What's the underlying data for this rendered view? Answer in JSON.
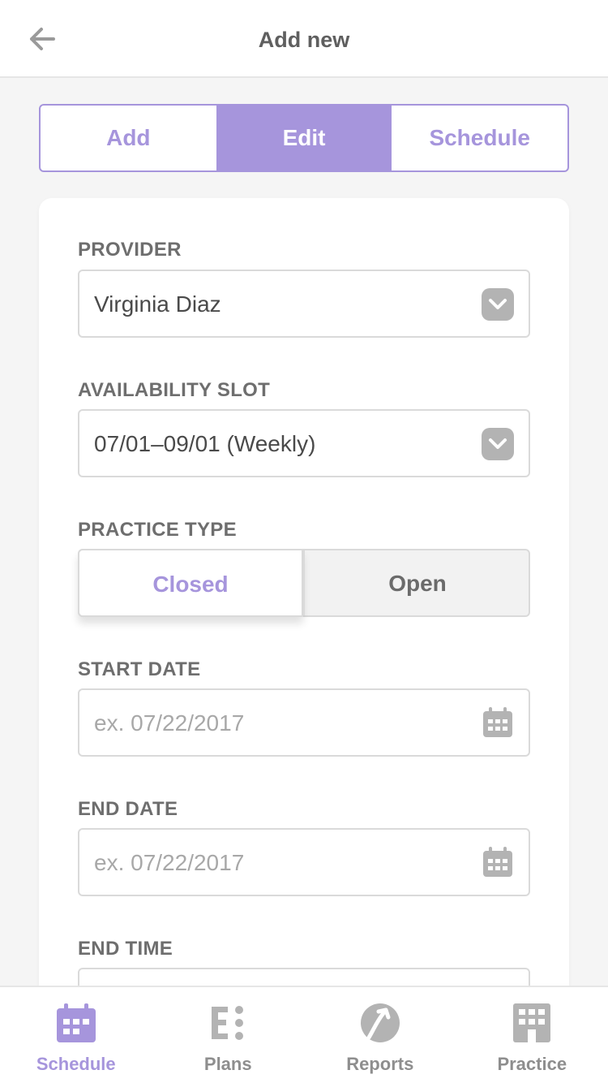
{
  "header": {
    "title": "Add new"
  },
  "tabs": [
    {
      "label": "Add",
      "active": false
    },
    {
      "label": "Edit",
      "active": true
    },
    {
      "label": "Schedule",
      "active": false
    }
  ],
  "form": {
    "provider": {
      "label": "PROVIDER",
      "value": "Virginia Diaz"
    },
    "availability": {
      "label": "AVAILABILITY SLOT",
      "value": "07/01–09/01 (Weekly)"
    },
    "practice_type": {
      "label": "PRACTICE TYPE",
      "options": [
        "Closed",
        "Open"
      ],
      "selected": "Closed"
    },
    "start_date": {
      "label": "START DATE",
      "placeholder": "ex. 07/22/2017"
    },
    "end_date": {
      "label": "END DATE",
      "placeholder": "ex. 07/22/2017"
    },
    "end_time": {
      "label": "END TIME"
    }
  },
  "bottom_nav": [
    {
      "label": "Schedule",
      "icon": "calendar-grid-icon",
      "active": true
    },
    {
      "label": "Plans",
      "icon": "plans-list-icon",
      "active": false
    },
    {
      "label": "Reports",
      "icon": "reports-arrow-icon",
      "active": false
    },
    {
      "label": "Practice",
      "icon": "building-icon",
      "active": false
    }
  ],
  "colors": {
    "accent": "#a695dc",
    "icon_gray": "#b3b3b3",
    "text": "#4a4a4a",
    "placeholder": "#a8a8a8",
    "background": "#f5f5f5"
  }
}
